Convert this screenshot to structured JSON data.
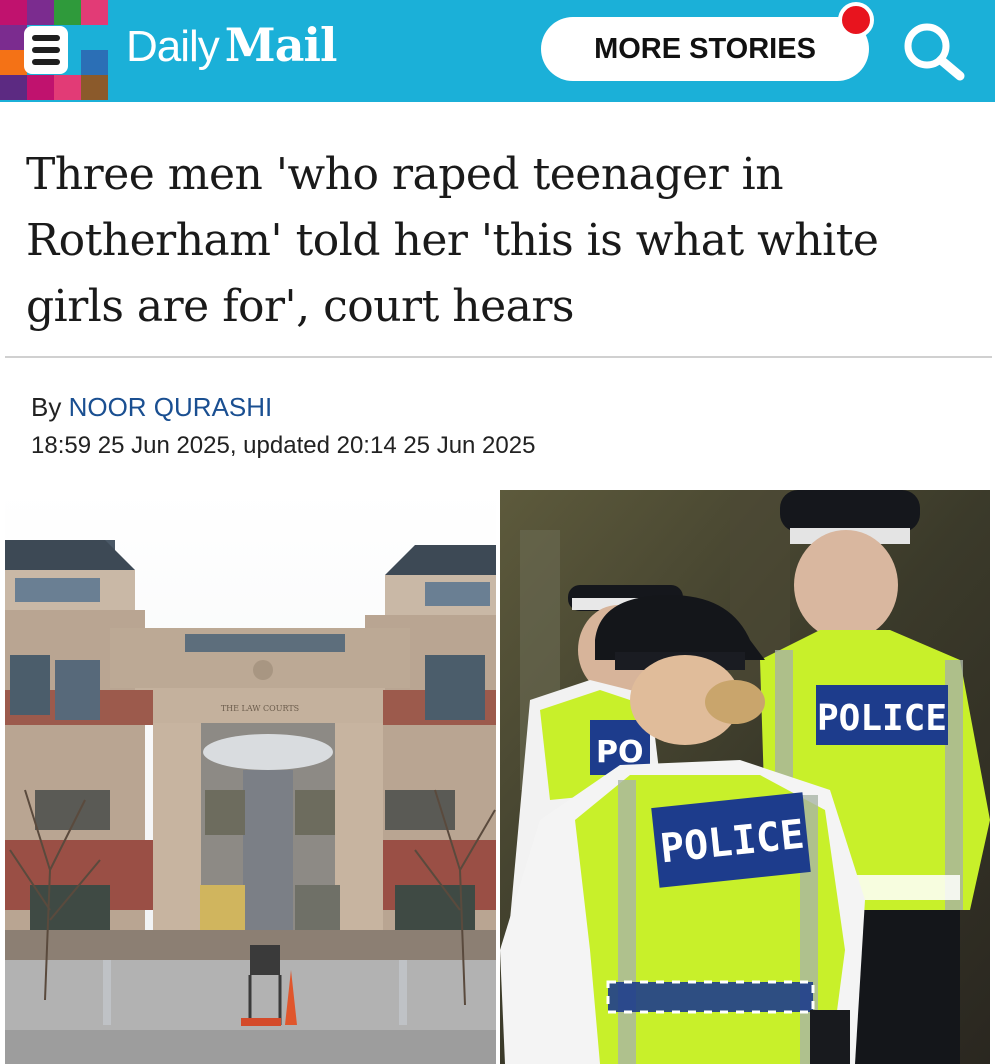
{
  "header": {
    "brand": {
      "daily": "Daily",
      "mail": "Mail"
    },
    "more_stories_label": "MORE STORIES",
    "icons": {
      "menu": "hamburger-menu-icon",
      "search": "search-icon",
      "notification": "notification-dot-icon"
    },
    "colors": {
      "bar": "#1bb0d8",
      "notification": "#e8141e"
    }
  },
  "article": {
    "headline": "Three men 'who raped teenager in Rotherham' told her 'this is what white girls are for', court hears",
    "byline_prefix": "By",
    "author": "NOOR QURASHI",
    "dateline": "18:59 25 Jun 2025, updated 20:14 25 Jun 2025"
  },
  "images": {
    "courthouse": {
      "sign": "THE LAW COURTS"
    },
    "police": {
      "vest_label": "POLICE",
      "vest_label_partial": "PO"
    }
  }
}
